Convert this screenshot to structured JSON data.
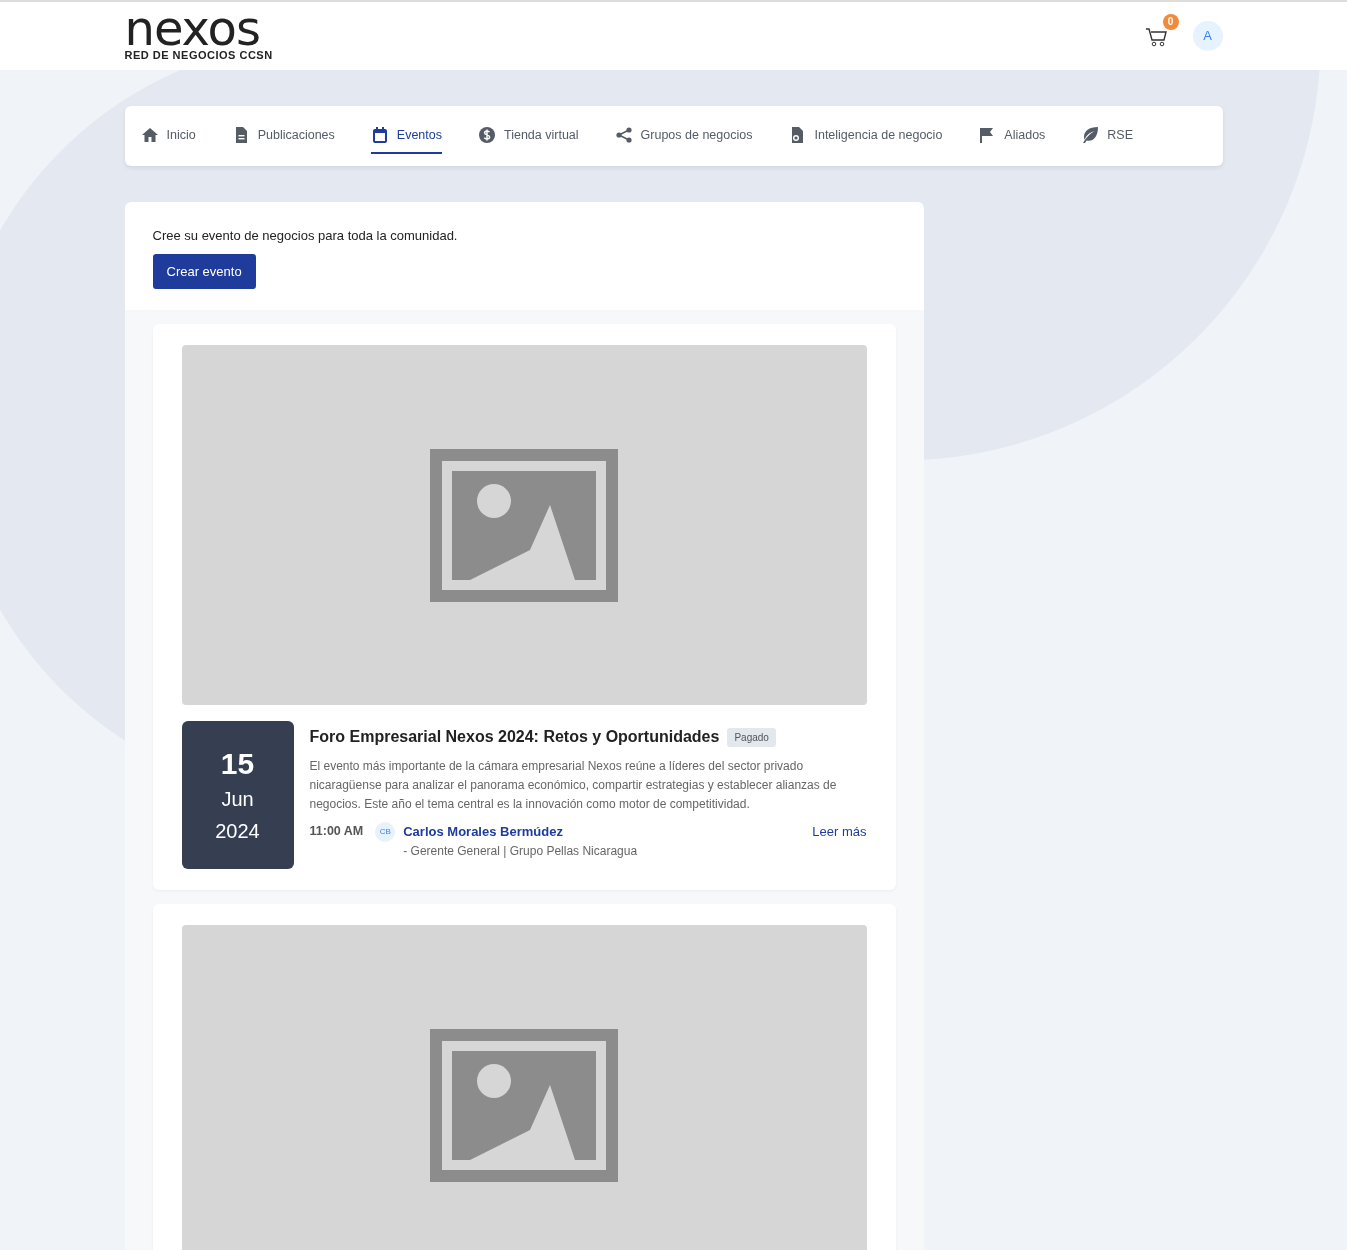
{
  "header": {
    "logo": "nexos",
    "tagline": "RED DE NEGOCIOS CCSN",
    "cart_count": "0",
    "avatar": "A"
  },
  "nav": [
    {
      "label": "Inicio",
      "selected": false
    },
    {
      "label": "Publicaciones",
      "selected": false
    },
    {
      "label": "Eventos",
      "selected": true
    },
    {
      "label": "Tienda virtual",
      "selected": false
    },
    {
      "label": "Grupos de negocios",
      "selected": false
    },
    {
      "label": "Inteligencia de negocio",
      "selected": false
    },
    {
      "label": "Aliados",
      "selected": false
    },
    {
      "label": "RSE",
      "selected": false
    }
  ],
  "create": {
    "text": "Cree su evento de negocios para toda la comunidad.",
    "button": "Crear evento"
  },
  "events": [
    {
      "kind": "event",
      "day": "15",
      "month": "Jun",
      "year": "2024",
      "title": "Foro Empresarial Nexos 2024: Retos y Oportunidades",
      "badge": "Pagado",
      "description": "El evento más importante de la cámara empresarial Nexos reúne a líderes del sector privado nicaragüense para analizar el panorama económico, compartir estrategias y establecer alianzas de negocios. Este año el tema central es la innovación como motor de competitividad.",
      "time": "11:00 AM",
      "initials": "CB",
      "speaker": "Carlos Morales Bermúdez",
      "role": "- Gerente General | Grupo Pellas Nicaragua",
      "more": "Leer más"
    },
    {
      "kind": "picture"
    }
  ]
}
